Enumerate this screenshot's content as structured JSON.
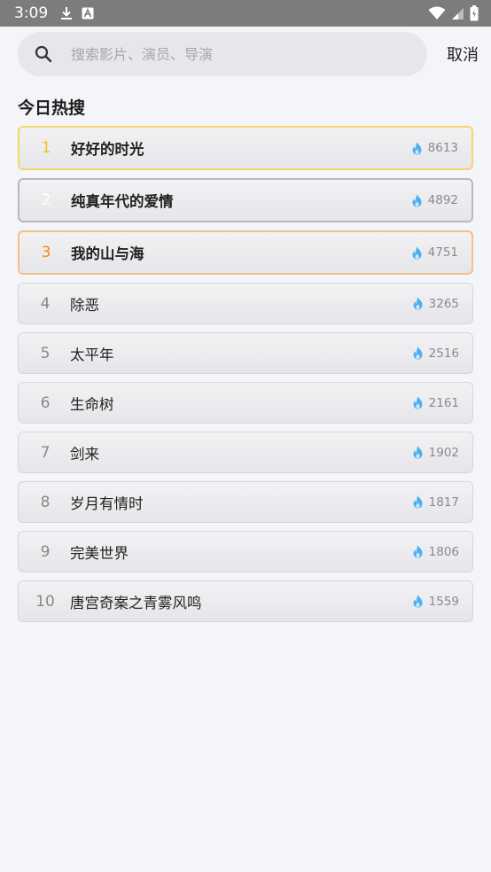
{
  "status_bar": {
    "time": "3:09",
    "icons_left": [
      "download-icon",
      "text-a-icon"
    ],
    "icons_right": [
      "wifi-icon",
      "signal-icon",
      "battery-icon"
    ]
  },
  "search": {
    "placeholder": "搜索影片、演员、导演",
    "value": "",
    "cancel_label": "取消"
  },
  "hot_section": {
    "title": "今日热搜",
    "items": [
      {
        "rank": "1",
        "title": "好好的时光",
        "heat": "8613"
      },
      {
        "rank": "2",
        "title": "纯真年代的爱情",
        "heat": "4892"
      },
      {
        "rank": "3",
        "title": "我的山与海",
        "heat": "4751"
      },
      {
        "rank": "4",
        "title": "除恶",
        "heat": "3265"
      },
      {
        "rank": "5",
        "title": "太平年",
        "heat": "2516"
      },
      {
        "rank": "6",
        "title": "生命树",
        "heat": "2161"
      },
      {
        "rank": "7",
        "title": "剑来",
        "heat": "1902"
      },
      {
        "rank": "8",
        "title": "岁月有情时",
        "heat": "1817"
      },
      {
        "rank": "9",
        "title": "完美世界",
        "heat": "1806"
      },
      {
        "rank": "10",
        "title": "唐宫奇案之青雾风鸣",
        "heat": "1559"
      }
    ]
  },
  "colors": {
    "rank1": "#f2c21b",
    "rank2": "#ffffff",
    "rank3": "#ef8a14",
    "heat_icon": "#4fb0f0"
  }
}
